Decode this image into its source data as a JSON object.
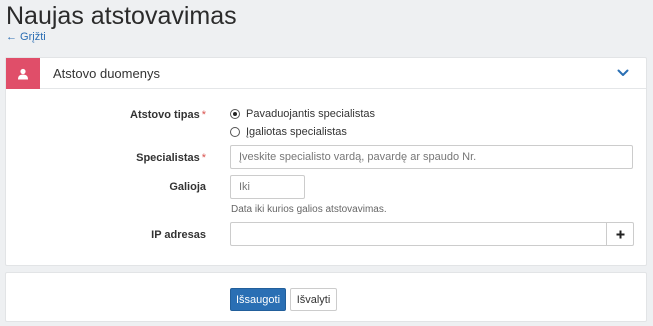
{
  "page": {
    "title": "Naujas atstovavimas",
    "back_link": "← Grįžti"
  },
  "panel": {
    "title": "Atstovo duomenys",
    "icon": "user-icon",
    "collapse_icon": "chevron-down-icon",
    "accent_color": "#e04e69"
  },
  "form": {
    "type_label": "Atstovo tipas",
    "required_mark": "*",
    "type_options": [
      {
        "label": "Pavaduojantis specialistas",
        "checked": true
      },
      {
        "label": "Įgaliotas specialistas",
        "checked": false
      }
    ],
    "specialist_label": "Specialistas",
    "specialist_placeholder": "Įveskite specialisto vardą, pavardę ar spaudo Nr.",
    "valid_label": "Galioja",
    "valid_placeholder": "Iki",
    "valid_help": "Data iki kurios galios atstovavimas.",
    "ip_label": "IP adresas",
    "ip_value": "",
    "ip_add_icon": "plus-icon"
  },
  "footer": {
    "save_label": "Išsaugoti",
    "clear_label": "Išvalyti",
    "primary_color": "#2a6fb4"
  }
}
